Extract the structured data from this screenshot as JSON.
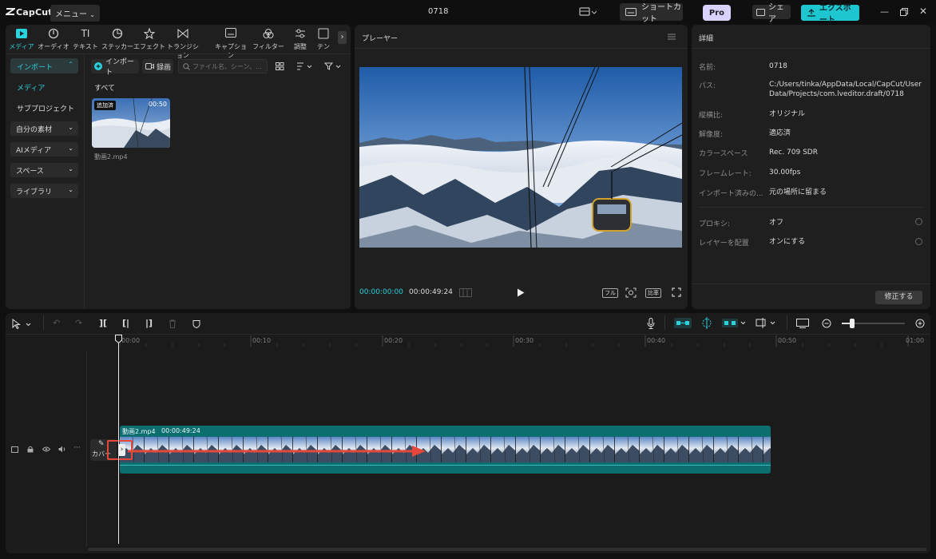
{
  "app": {
    "logo": "CapCut",
    "menu_label": "メニュー",
    "project_title": "0718",
    "shortcut_label": "ショートカット",
    "pro_label": "Pro",
    "share_label": "シェア",
    "export_label": "エクスポート"
  },
  "toolbar_tabs": [
    {
      "label": "メディア",
      "icon": "media-icon",
      "active": true
    },
    {
      "label": "オーディオ",
      "icon": "audio-icon"
    },
    {
      "label": "テキスト",
      "icon": "text-icon"
    },
    {
      "label": "ステッカー",
      "icon": "sticker-icon"
    },
    {
      "label": "エフェクト",
      "icon": "effect-icon"
    },
    {
      "label": "トランジション",
      "icon": "transition-icon"
    },
    {
      "label": "キャプション",
      "icon": "caption-icon"
    },
    {
      "label": "フィルター",
      "icon": "filter-icon"
    },
    {
      "label": "調整",
      "icon": "adjust-icon"
    },
    {
      "label": "テン",
      "icon": "template-icon"
    }
  ],
  "media_sidebar": {
    "import_label": "インポート",
    "media_label": "メディア",
    "subproject_label": "サブプロジェクト",
    "my_assets_label": "自分の素材",
    "ai_media_label": "AIメディア",
    "spaces_label": "スペース",
    "library_label": "ライブラリ"
  },
  "media_panel": {
    "import_button": "インポート",
    "record_button": "録画",
    "search_placeholder": "ファイル名、シーン、...",
    "all_label": "すべて",
    "clip": {
      "badge": "追加済",
      "duration": "00:50",
      "name": "動画2.mp4"
    }
  },
  "player": {
    "title": "プレーヤー",
    "current_time": "00:00:00:00",
    "total_time": "00:00:49:24",
    "full_label": "フル",
    "ratio_label": "比率"
  },
  "details": {
    "title": "詳細",
    "rows": [
      {
        "label": "名前:",
        "value": "0718"
      },
      {
        "label": "パス:",
        "value": "C:/Users/tinka/AppData/Local/CapCut/User Data/Projects/com.lveditor.draft/0718"
      },
      {
        "label": "縦横比:",
        "value": "オリジナル"
      },
      {
        "label": "解像度:",
        "value": "適応済"
      },
      {
        "label": "カラースペース",
        "value": "Rec. 709 SDR"
      },
      {
        "label": "フレームレート:",
        "value": "30.00fps"
      },
      {
        "label": "インポート済みの...",
        "value": "元の場所に留まる"
      },
      {
        "label": "プロキシ:",
        "value": "オフ"
      },
      {
        "label": "レイヤーを配置",
        "value": "オンにする"
      }
    ],
    "modify_button": "修正する"
  },
  "timeline": {
    "ticks": [
      "00:00",
      "00:10",
      "00:20",
      "00:30",
      "00:40",
      "00:50",
      "01:00"
    ],
    "clip_name": "動画2.mp4",
    "clip_duration": "00:00:49:24",
    "cover_label": "カバー"
  },
  "colors": {
    "accent": "#2ad2dc",
    "clip_teal": "#0d6e70",
    "arrow_red": "#e5483a"
  }
}
